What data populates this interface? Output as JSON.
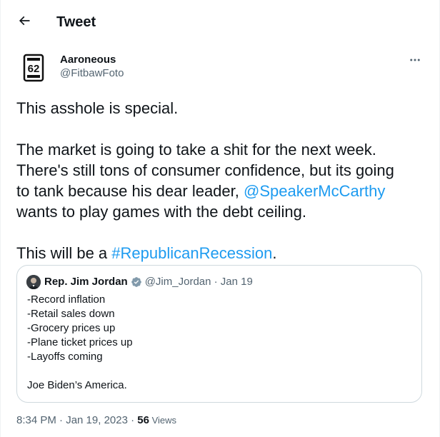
{
  "header": {
    "title": "Tweet",
    "back_icon": "arrow-left-icon"
  },
  "author": {
    "name": "Aaroneous",
    "handle": "@FitbawFoto",
    "avatar_text": "62"
  },
  "tweet": {
    "line1": "This asshole is special.",
    "para2_line1": "The market is going to take a shit for the next week.",
    "para2_line2": "There's still tons of consumer confidence, but its going",
    "para2_line3_prefix": "to tank because his dear leader, ",
    "mention": "@SpeakerMcCarthy",
    "para2_line4": "wants to play games with the debt ceiling.",
    "para3_prefix": "This will be a ",
    "hashtag": "#RepublicanRecession",
    "para3_suffix": "."
  },
  "quote": {
    "name": "Rep. Jim Jordan",
    "handle_time": "@Jim_Jordan · Jan 19",
    "lines": [
      "-Record inflation",
      "-Retail sales down",
      "-Grocery prices up",
      "-Plane ticket prices up",
      "-Layoffs coming"
    ],
    "closing": "Joe Biden’s America."
  },
  "meta": {
    "timestamp": "8:34 PM · Jan 19, 2023 · ",
    "views_count": "56",
    "views_label": " Views"
  },
  "colors": {
    "link": "#1d9bf0",
    "secondary_text": "#536471",
    "border": "#cfd9de",
    "verified_badge": "#829aab"
  }
}
